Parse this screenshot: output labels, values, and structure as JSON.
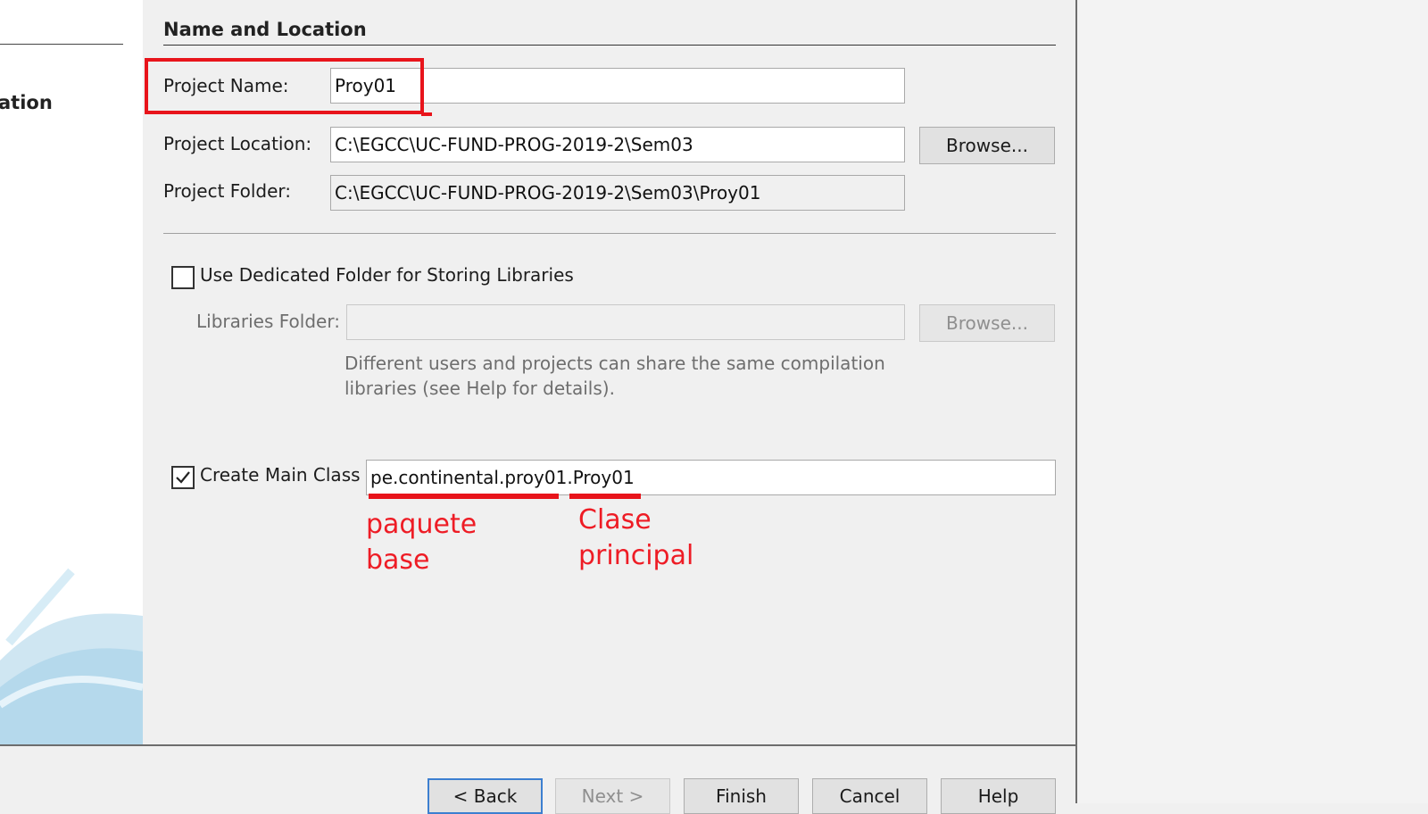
{
  "left_panel": {
    "step_label": "ation"
  },
  "section": {
    "title": "Name and Location"
  },
  "project_name": {
    "label": "Project Name:",
    "value": "Proy01"
  },
  "project_location": {
    "label": "Project Location:",
    "value": "C:\\EGCC\\UC-FUND-PROG-2019-2\\Sem03",
    "browse_label": "Browse..."
  },
  "project_folder": {
    "label": "Project Folder:",
    "value": "C:\\EGCC\\UC-FUND-PROG-2019-2\\Sem03\\Proy01"
  },
  "libraries": {
    "checkbox_label": "Use Dedicated Folder for Storing Libraries",
    "checked": false,
    "folder_label": "Libraries Folder:",
    "folder_value": "",
    "browse_label": "Browse...",
    "hint_line1": "Different users and projects can share the same compilation",
    "hint_line2": "libraries (see Help for details)."
  },
  "main_class": {
    "checkbox_label": "Create Main Class",
    "checked": true,
    "value": "pe.continental.proy01.Proy01"
  },
  "annotations": {
    "package_line1": "paquete",
    "package_line2": "base",
    "class_line1": "Clase",
    "class_line2": "principal",
    "color": "#ee1c25"
  },
  "footer": {
    "back_label": "< Back",
    "next_label": "Next >",
    "finish_label": "Finish",
    "cancel_label": "Cancel",
    "help_label": "Help"
  }
}
